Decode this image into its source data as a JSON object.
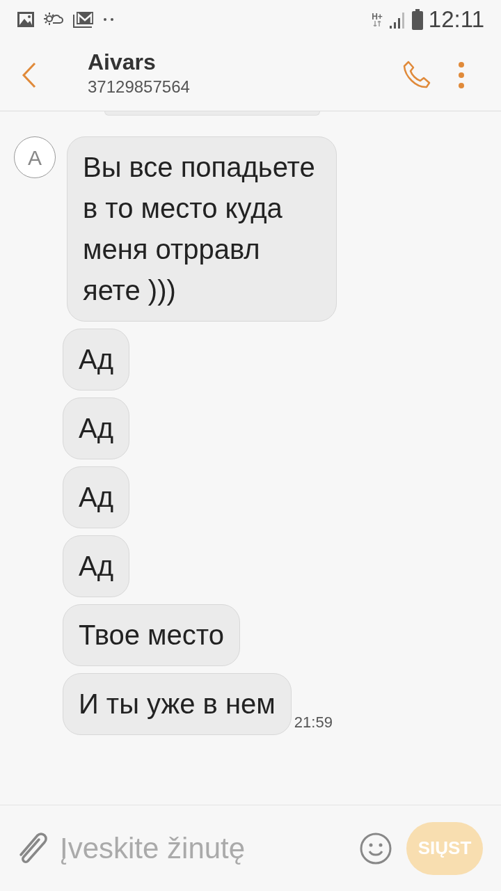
{
  "status_bar": {
    "time": "12:11",
    "network": "H+"
  },
  "header": {
    "name": "Aivars",
    "number": "37129857564"
  },
  "messages": [
    {
      "text": "Вы все попадьете  в то место куда меня отрравл яете )))",
      "avatar": "A"
    },
    {
      "text": "Ад"
    },
    {
      "text": "Ад"
    },
    {
      "text": "Ад"
    },
    {
      "text": "Ад"
    },
    {
      "text": "Твое место"
    },
    {
      "text": "И ты уже в нем",
      "time": "21:59"
    }
  ],
  "composer": {
    "placeholder": "Įveskite žinutę",
    "send_label": "SIŲST",
    "send_disabled": true
  }
}
